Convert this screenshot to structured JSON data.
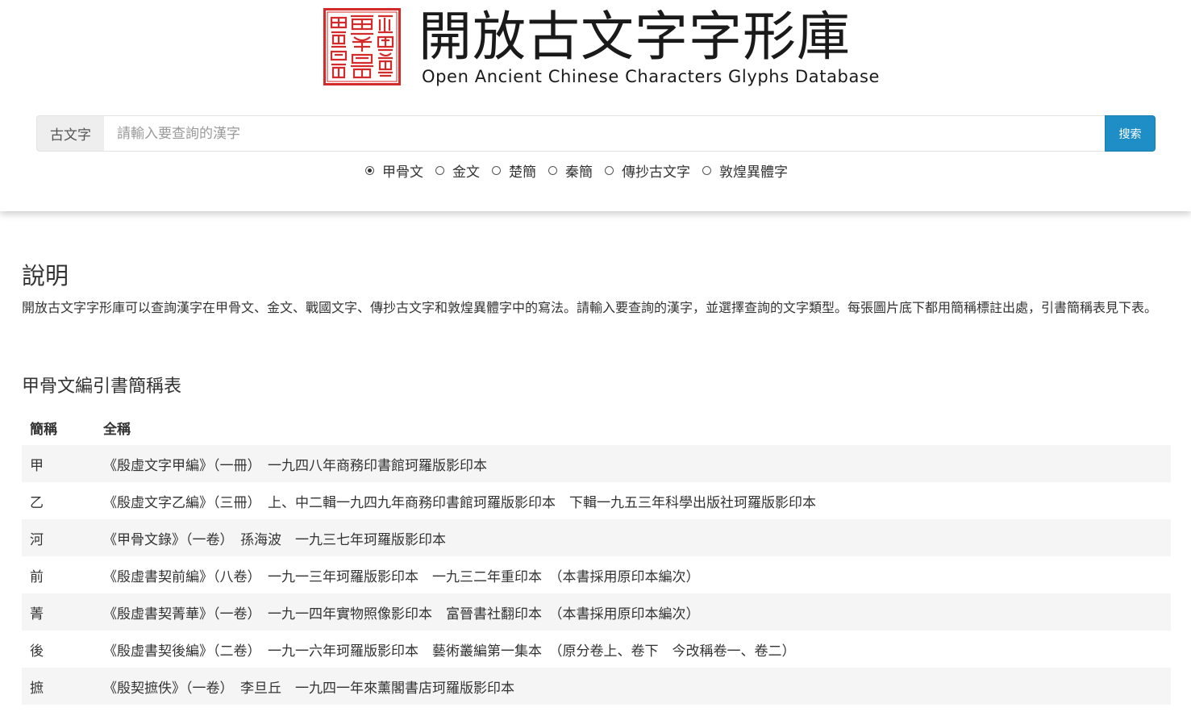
{
  "header": {
    "title_zh": "開放古文字字形庫",
    "title_en": "Open Ancient Chinese Characters Glyphs Database"
  },
  "search": {
    "addon_label": "古文字",
    "placeholder": "請輸入要查詢的漢字",
    "value": "",
    "button_label": "搜索"
  },
  "script_types": [
    {
      "label": "甲骨文",
      "checked": true
    },
    {
      "label": "金文",
      "checked": false
    },
    {
      "label": "楚簡",
      "checked": false
    },
    {
      "label": "秦簡",
      "checked": false
    },
    {
      "label": "傳抄古文字",
      "checked": false
    },
    {
      "label": "敦煌異體字",
      "checked": false
    }
  ],
  "main": {
    "section_title": "說明",
    "description": "開放古文字字形庫可以查詢漢字在甲骨文、金文、戰國文字、傳抄古文字和敦煌異體字中的寫法。請輸入要查詢的漢字，並選擇查詢的文字類型。每張圖片底下都用簡稱標註出處，引書簡稱表見下表。",
    "table_title": "甲骨文編引書簡稱表",
    "columns": [
      "簡稱",
      "全稱"
    ],
    "rows": [
      {
        "abbr": "甲",
        "full": "《殷虛文字甲編》（一冊）　一九四八年商務印書館珂羅版影印本"
      },
      {
        "abbr": "乙",
        "full": "《殷虛文字乙編》（三冊）　上、中二輯一九四九年商務印書館珂羅版影印本　下輯一九五三年科學出版社珂羅版影印本"
      },
      {
        "abbr": "河",
        "full": "《甲骨文錄》（一卷）　孫海波　一九三七年珂羅版影印本"
      },
      {
        "abbr": "前",
        "full": "《殷虛書契前編》（八卷）　一九一三年珂羅版影印本　一九三二年重印本　（本書採用原印本編次）"
      },
      {
        "abbr": "菁",
        "full": "《殷虛書契菁華》（一卷）　一九一四年實物照像影印本　富晉書社翻印本　（本書採用原印本編次）"
      },
      {
        "abbr": "後",
        "full": "《殷虛書契後編》（二卷）　一九一六年珂羅版影印本　藝術叢編第一集本　（原分卷上、卷下　今改稱卷一、卷二）"
      },
      {
        "abbr": "摭",
        "full": "《殷契摭佚》（一卷）　李旦丘　一九四一年來薰閣書店珂羅版影印本"
      }
    ]
  },
  "colors": {
    "accent": "#1f8dc6",
    "seal_red": "#d42a2a",
    "row_stripe": "#f5f5f5"
  }
}
